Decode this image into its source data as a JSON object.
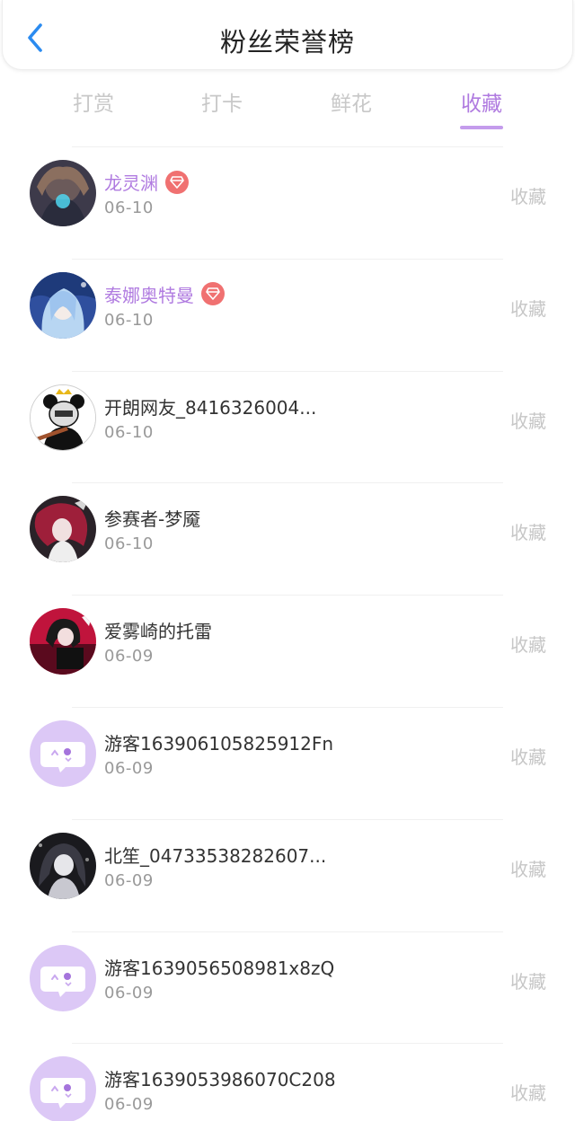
{
  "header": {
    "title": "粉丝荣誉榜"
  },
  "tabs": [
    {
      "label": "打赏"
    },
    {
      "label": "打卡"
    },
    {
      "label": "鲜花"
    },
    {
      "label": "收藏"
    }
  ],
  "active_tab": "收藏",
  "colors": {
    "accent": "#b07be0",
    "badge": "#f07171",
    "guest_avatar_bg": "#dcc8f6",
    "muted": "#c6c6c6"
  },
  "fans": [
    {
      "name": "龙灵渊",
      "date": "06-10",
      "action": "收藏",
      "badge_icon": "gem-icon",
      "avatar": "anime-avatar-dark"
    },
    {
      "name": "泰娜奥特曼",
      "date": "06-10",
      "action": "收藏",
      "badge_icon": "gem-icon",
      "avatar": "anime-avatar-blue"
    },
    {
      "name": "开朗网友_8416326004...",
      "date": "06-10",
      "action": "收藏",
      "avatar": "panda-meme-avatar"
    },
    {
      "name": "参赛者-梦魇",
      "date": "06-10",
      "action": "收藏",
      "avatar": "anime-avatar-red"
    },
    {
      "name": "爱雾崎的托雷",
      "date": "06-09",
      "action": "收藏",
      "avatar": "anime-avatar-crimson"
    },
    {
      "name": "游客163906105825912Fn",
      "date": "06-09",
      "action": "收藏",
      "avatar": "guest-chat-avatar"
    },
    {
      "name": "北笙_04733538282607...",
      "date": "06-09",
      "action": "收藏",
      "avatar": "anime-avatar-monochrome"
    },
    {
      "name": "游客1639056508981x8zQ",
      "date": "06-09",
      "action": "收藏",
      "avatar": "guest-chat-avatar"
    },
    {
      "name": "游客1639053986070C208",
      "date": "06-09",
      "action": "收藏",
      "avatar": "guest-chat-avatar"
    }
  ]
}
